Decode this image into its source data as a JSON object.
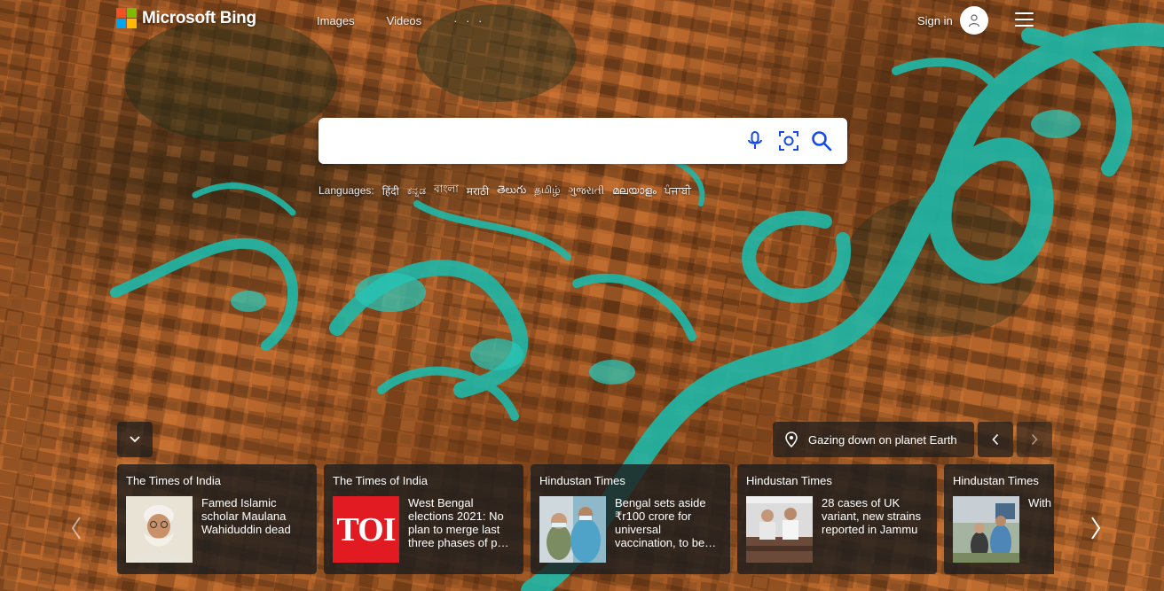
{
  "header": {
    "logo_text": "Microsoft Bing",
    "nav": [
      {
        "label": "Images"
      },
      {
        "label": "Videos"
      },
      {
        "label": "· · ·"
      }
    ],
    "sign_in_label": "Sign in"
  },
  "search": {
    "value": "",
    "placeholder": ""
  },
  "languages": {
    "label": "Languages:",
    "items": [
      "हिंदी",
      "ಕನ್ನಡ",
      "বাংলা",
      "मराठी",
      "తెలుగు",
      "தமிழ்",
      "ગુજરાતી",
      "മലയാളം",
      "ਪੰਜਾਬੀ"
    ]
  },
  "image_caption": "Gazing down on planet Earth",
  "news": [
    {
      "source": "The Times of India",
      "title": "Famed Islamic scholar Maulana Wahiduddin dead"
    },
    {
      "source": "The Times of India",
      "title": "West Bengal elections 2021: No plan to merge last three phases of p…",
      "thumb_text": "TOI"
    },
    {
      "source": "Hindustan Times",
      "title": "Bengal sets aside ₹r100 crore for universal vaccination, to be…"
    },
    {
      "source": "Hindustan Times",
      "title": "28 cases of UK variant, new strains reported in Jammu"
    },
    {
      "source": "Hindustan Times",
      "title": "With J&K ever again"
    }
  ],
  "colors": {
    "ms_red": "#f25022",
    "ms_green": "#7fba00",
    "ms_blue": "#00a4ef",
    "ms_yellow": "#ffb900",
    "search_icon_blue": "#174ae4",
    "toi_red": "#e21b22",
    "river_teal": "#1fb8a8"
  },
  "icons": [
    "microphone-icon",
    "visual-search-icon",
    "search-icon",
    "location-pin-icon",
    "chevron-down-icon",
    "chevron-left-icon",
    "chevron-right-icon",
    "user-icon",
    "hamburger-menu-icon"
  ]
}
